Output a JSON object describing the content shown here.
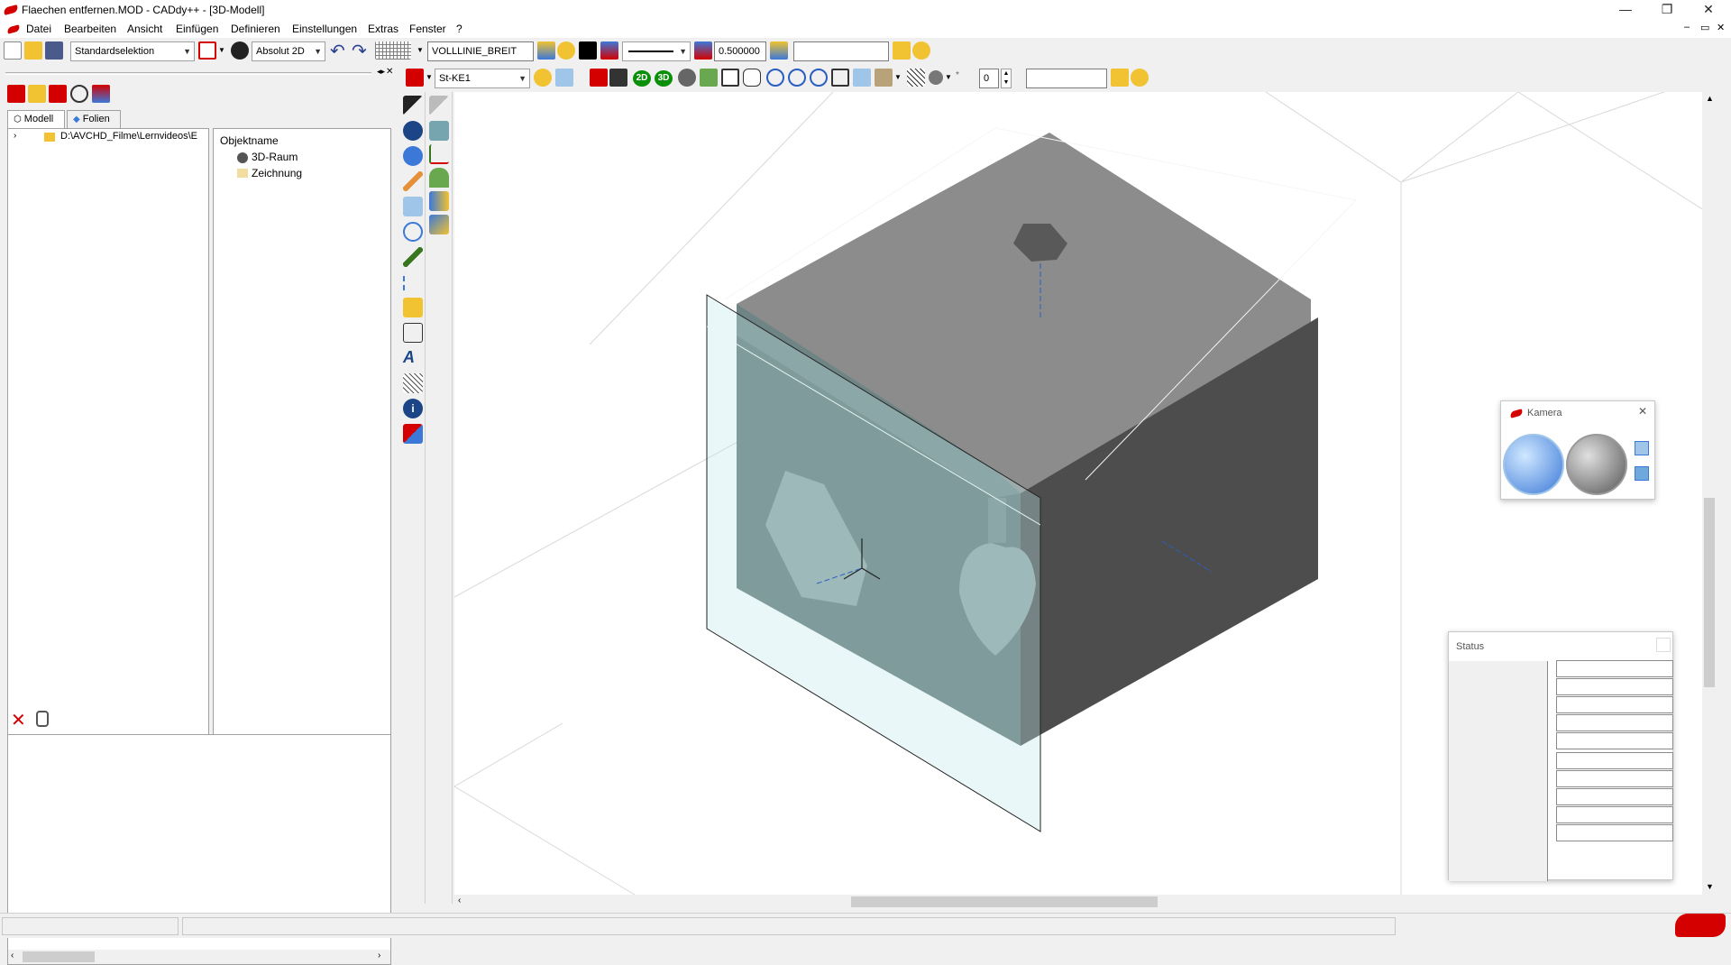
{
  "window": {
    "title": "Flaechen entfernen.MOD  -  CADdy++ - [3D-Modell]",
    "minimize": "—",
    "restore": "❐",
    "close": "✕"
  },
  "mdi": {
    "minimize": "–",
    "restore": "▭",
    "close": "✕"
  },
  "menu": [
    "Datei",
    "Bearbeiten",
    "Ansicht",
    "Einfügen",
    "Definieren",
    "Einstellungen",
    "Extras",
    "Fenster",
    "?"
  ],
  "toolbar1": {
    "selection_mode": "Standardselektion",
    "coord_mode": "Absolut 2D",
    "line_type": "VOLLLINIE_BREIT",
    "line_width": "0.500000",
    "layer_field": ""
  },
  "toolbar2": {
    "material": "St-KE1",
    "btn_2d": "2D",
    "btn_3d": "3D",
    "spin_value": "0",
    "field": ""
  },
  "sidebar": {
    "tabs": [
      "Modell",
      "Folien"
    ],
    "tree_path": "D:\\AVCHD_Filme\\Lernvideos\\E",
    "object_header": "Objektname",
    "objects": [
      "3D-Raum",
      "Zeichnung"
    ]
  },
  "camera_window": {
    "title": "Kamera"
  },
  "status_window": {
    "title": "Status"
  },
  "colors": {
    "accent": "#d40000",
    "cube_top": "#8c8c8c",
    "cube_front": "#4d4d4d",
    "cube_left": "#5e7272",
    "plane": "#bfe8ec"
  }
}
